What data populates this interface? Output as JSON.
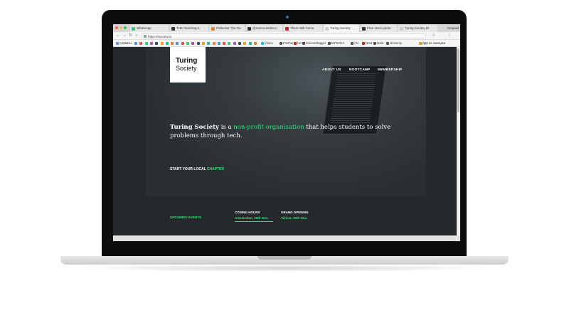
{
  "browser": {
    "tabs": [
      {
        "label": "WhatsApp",
        "color": "#2ecc71"
      },
      {
        "label": "THE-Teaching-a",
        "color": "#333333"
      },
      {
        "label": "Putlocker The Ru",
        "color": "#e67e22"
      },
      {
        "label": "@marco.andrei.n",
        "color": "#333333"
      },
      {
        "label": "There Will Come",
        "color": "#cc2222"
      },
      {
        "label": "Turing Society",
        "color": "#cccccc"
      },
      {
        "label": "Free stock photo",
        "color": "#333333"
      },
      {
        "label": "Turing Society Bl",
        "color": "#cccccc"
      }
    ],
    "profile": "Георгий",
    "url": "https://tsociety.io",
    "bookmarks": [
      {
        "label": "Сервисы",
        "color": "#6a8fd8"
      },
      {
        "label": "Vimeo",
        "color": "#1ab7ea"
      },
      {
        "label": "Fresher",
        "color": "#555555"
      },
      {
        "label": "Heт",
        "color": "#cc2222"
      },
      {
        "label": "scienceblogger",
        "color": "#555555"
      },
      {
        "label": "BitTorrent",
        "color": "#555555"
      },
      {
        "label": "AN",
        "color": "#555555"
      },
      {
        "label": "fama",
        "color": "#cc2222"
      },
      {
        "label": "static",
        "color": "#555555"
      },
      {
        "label": "elementy",
        "color": "#555555"
      },
      {
        "label": "Другие закладки",
        "color": "#d4a017"
      }
    ]
  },
  "site": {
    "logo_line1": "Turing",
    "logo_line2": "Society",
    "nav": [
      "ABOUT US",
      "BOOTCAMP",
      "MEMBERSHIP"
    ],
    "tagline_brand": "Turing Society",
    "tagline_mid1": " is a ",
    "tagline_highlight": "non-profit organisation",
    "tagline_rest": " that helps students to solve problems through tech.",
    "cta_prefix": "START YOUR LOCAL ",
    "cta_highlight": "CHAPTER",
    "events_title": "UPCOMING EVENTS",
    "events": [
      {
        "name": "CODING HOURS",
        "detail": "Amsterdam, 29th Nov."
      },
      {
        "name": "GRAND OPENING",
        "detail": "Vilnius, 30th Nov."
      }
    ]
  },
  "colors": {
    "accent": "#2fe07a",
    "page_bg": "#26292c"
  }
}
